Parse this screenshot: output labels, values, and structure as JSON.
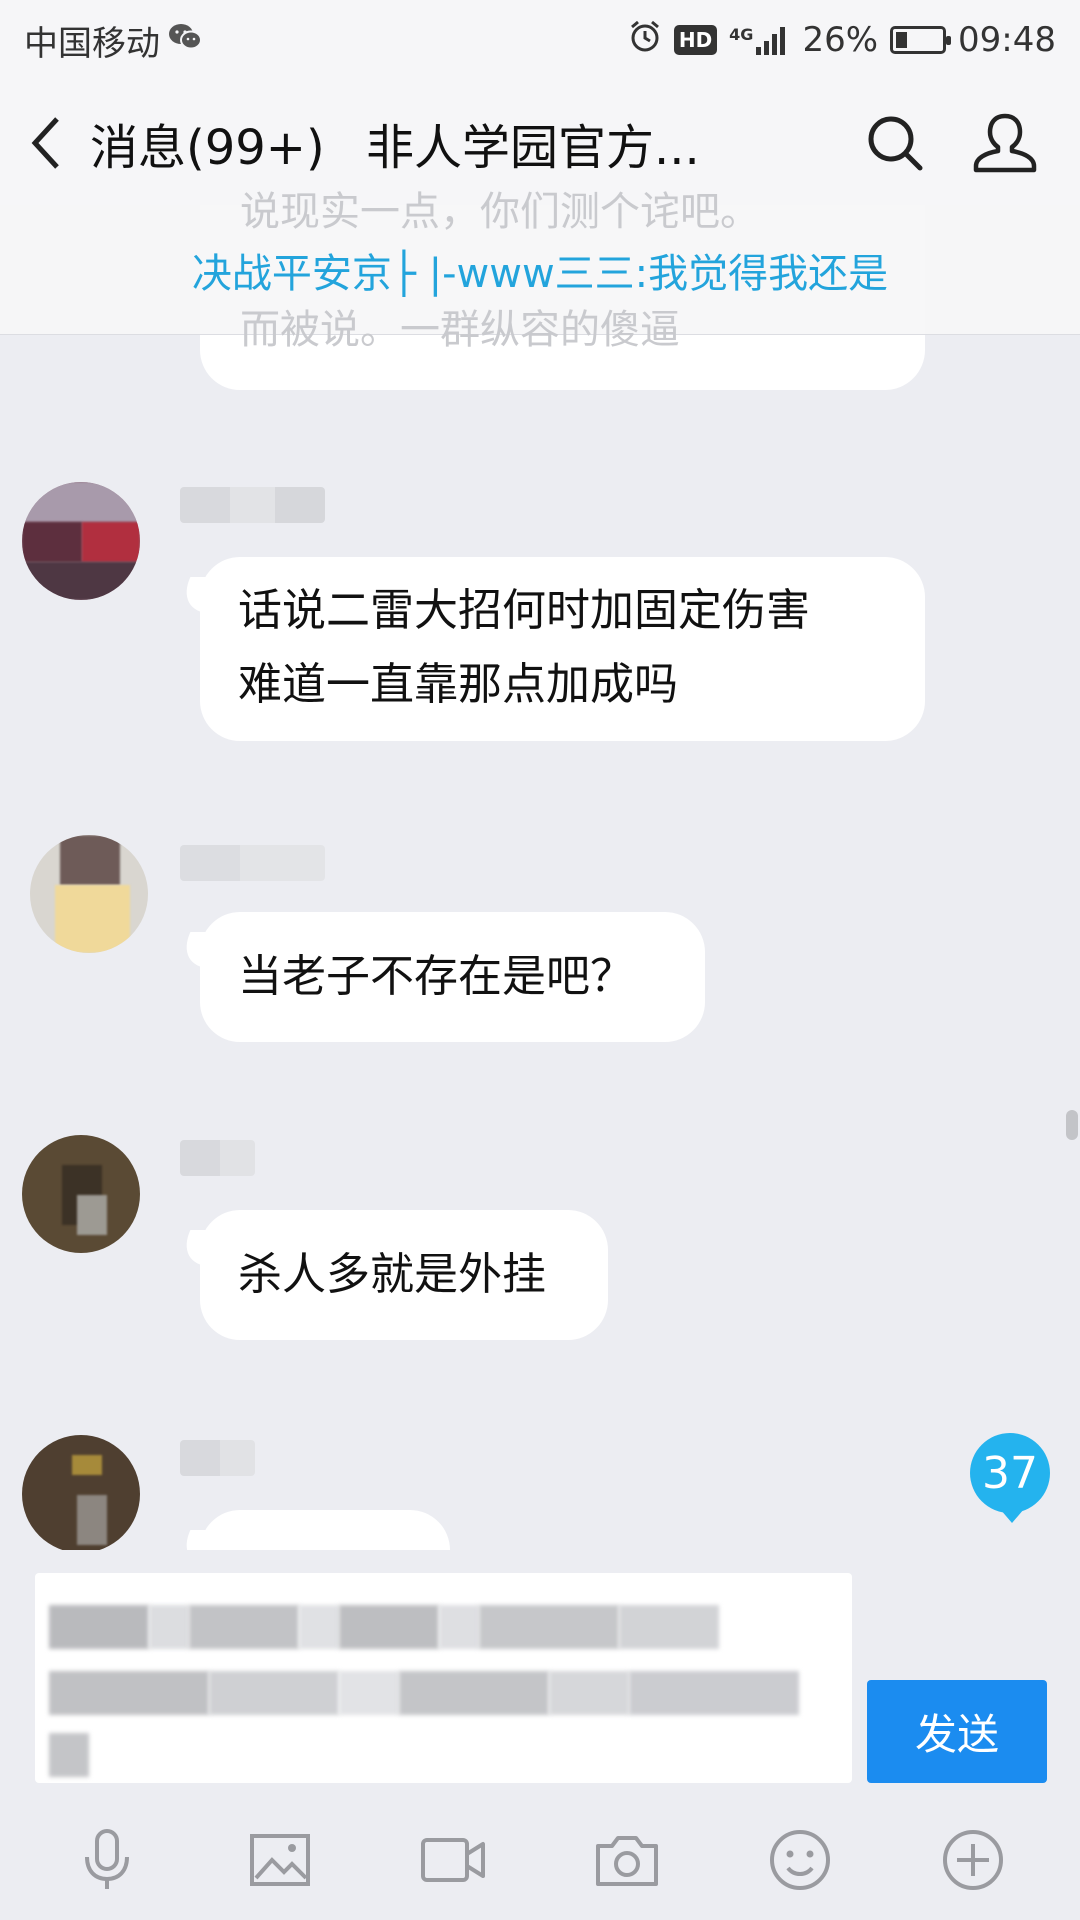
{
  "status_bar": {
    "carrier": "中国移动",
    "hd_label": "HD",
    "network": "4G",
    "battery_percent": "26%",
    "battery_level": 0.26,
    "time": "09:48"
  },
  "nav": {
    "back_label": "消息(99+)",
    "title": "非人学园官方..."
  },
  "announcement": {
    "text": "决战平安京├ |-www三三:我觉得我还是",
    "ghost_line_top": "说现实一点，你们测个诧吧。",
    "ghost_line_bottom": "而被说。一群纵容的傻逼"
  },
  "messages": [
    {
      "text_lines": [
        "话说二雷大招何时加固定伤害",
        "难道一直靠那点加成吗"
      ]
    },
    {
      "text_lines": [
        "当老子不存在是吧？"
      ]
    },
    {
      "text_lines": [
        "杀人多就是外挂"
      ]
    }
  ],
  "new_message_count": "37",
  "input": {
    "send_label": "发送"
  },
  "colors": {
    "accent": "#1b8cf0",
    "announce_text": "#23a4dc",
    "badge": "#24b3ee",
    "background": "#ecedf2"
  },
  "toolbar_icons": [
    "microphone-icon",
    "image-icon",
    "video-icon",
    "camera-icon",
    "emoji-icon",
    "plus-icon"
  ]
}
